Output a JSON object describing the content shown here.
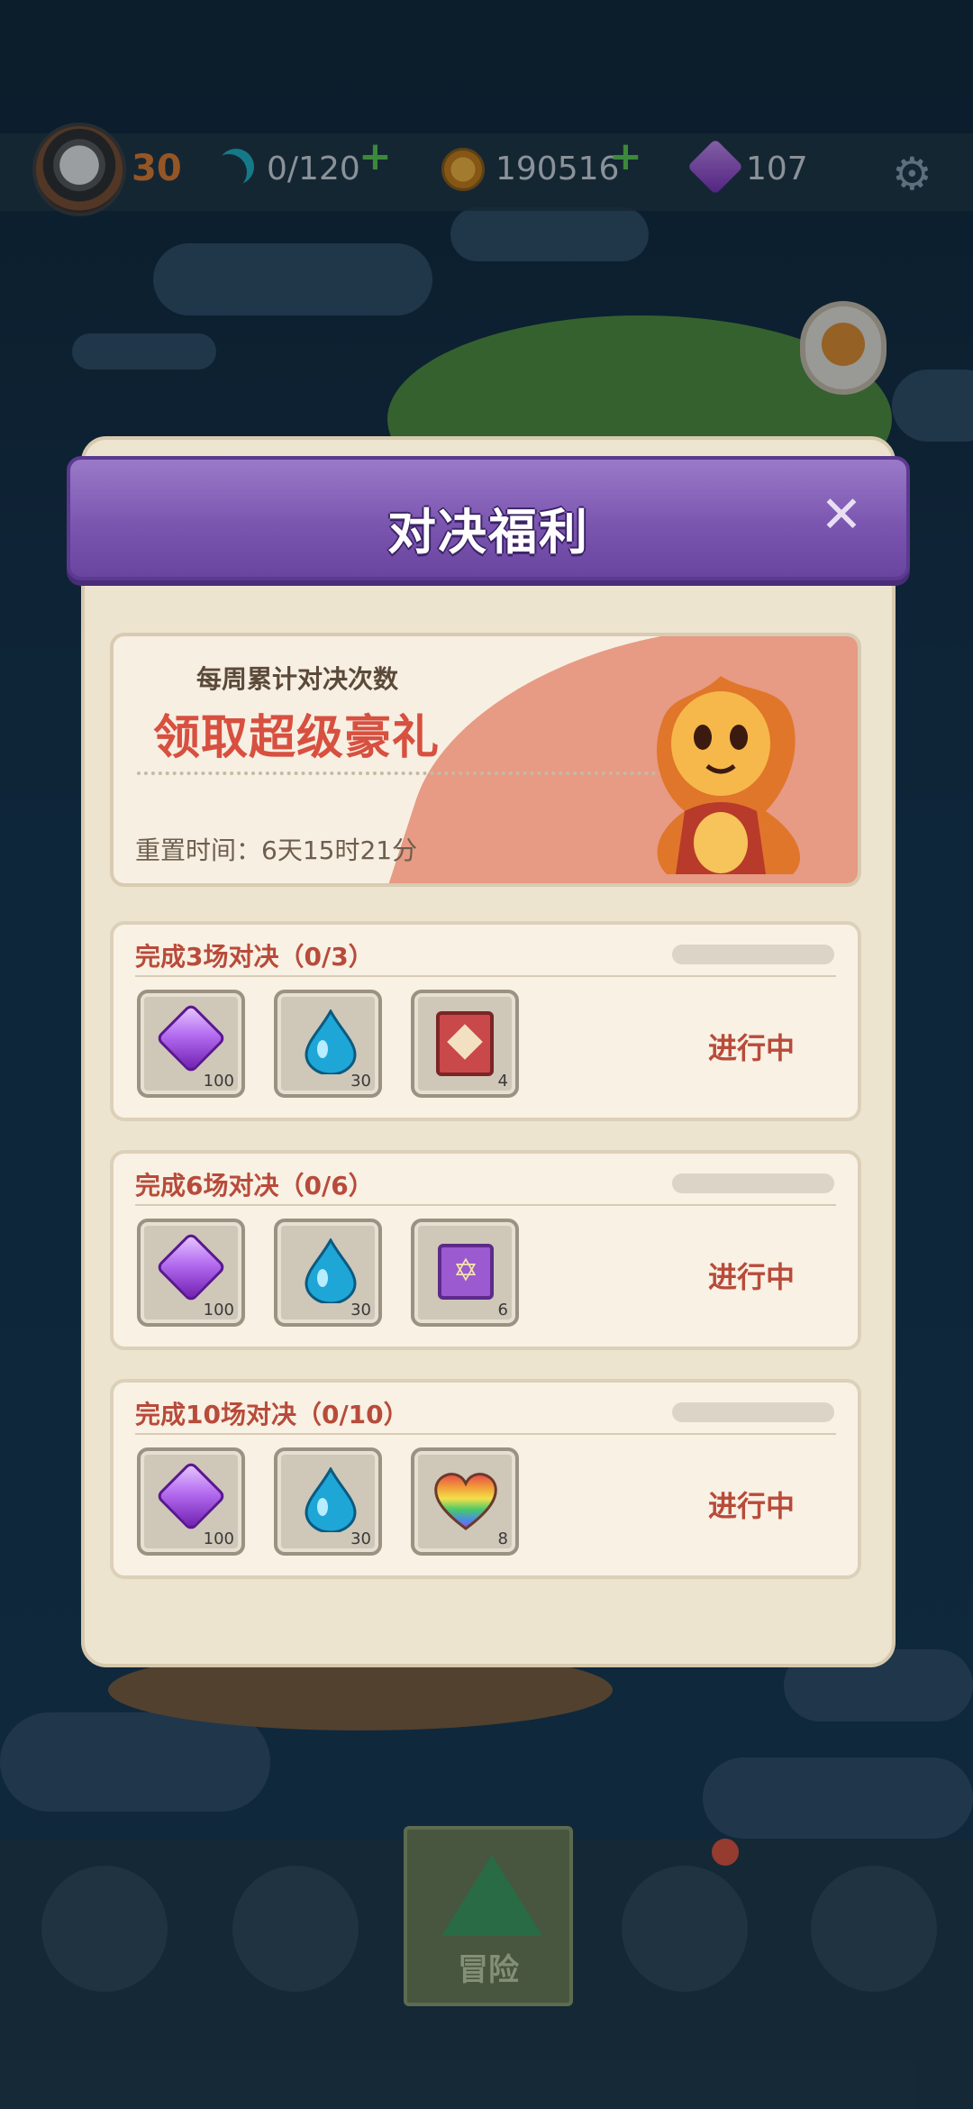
{
  "topbar": {
    "level": "30",
    "energy": "0/120",
    "coins": "190516",
    "gems": "107"
  },
  "modal": {
    "title": "对决福利",
    "banner": {
      "subtitle": "每周累计对决次数",
      "headline": "领取超级豪礼",
      "reset_time": "重置时间：6天15时21分"
    },
    "tasks": [
      {
        "title": "完成3场对决（0/3）",
        "progress": 0,
        "status": "进行中",
        "rewards": [
          {
            "icon": "purple-gem-icon",
            "qty": "100"
          },
          {
            "icon": "water-drop-icon",
            "qty": "30"
          },
          {
            "icon": "red-book-icon",
            "qty": "4"
          }
        ]
      },
      {
        "title": "完成6场对决（0/6）",
        "progress": 0,
        "status": "进行中",
        "rewards": [
          {
            "icon": "purple-gem-icon",
            "qty": "100"
          },
          {
            "icon": "water-drop-icon",
            "qty": "30"
          },
          {
            "icon": "star-card-icon",
            "qty": "6"
          }
        ]
      },
      {
        "title": "完成10场对决（0/10）",
        "progress": 0,
        "status": "进行中",
        "rewards": [
          {
            "icon": "purple-gem-icon",
            "qty": "100"
          },
          {
            "icon": "water-drop-icon",
            "qty": "30"
          },
          {
            "icon": "rainbow-heart-icon",
            "qty": "8"
          }
        ]
      }
    ]
  },
  "nav": {
    "active_label": "冒险"
  },
  "colors": {
    "header_purple": "#7b56b0",
    "accent_red": "#b84b3a",
    "banner_pink": "#e79a84"
  }
}
